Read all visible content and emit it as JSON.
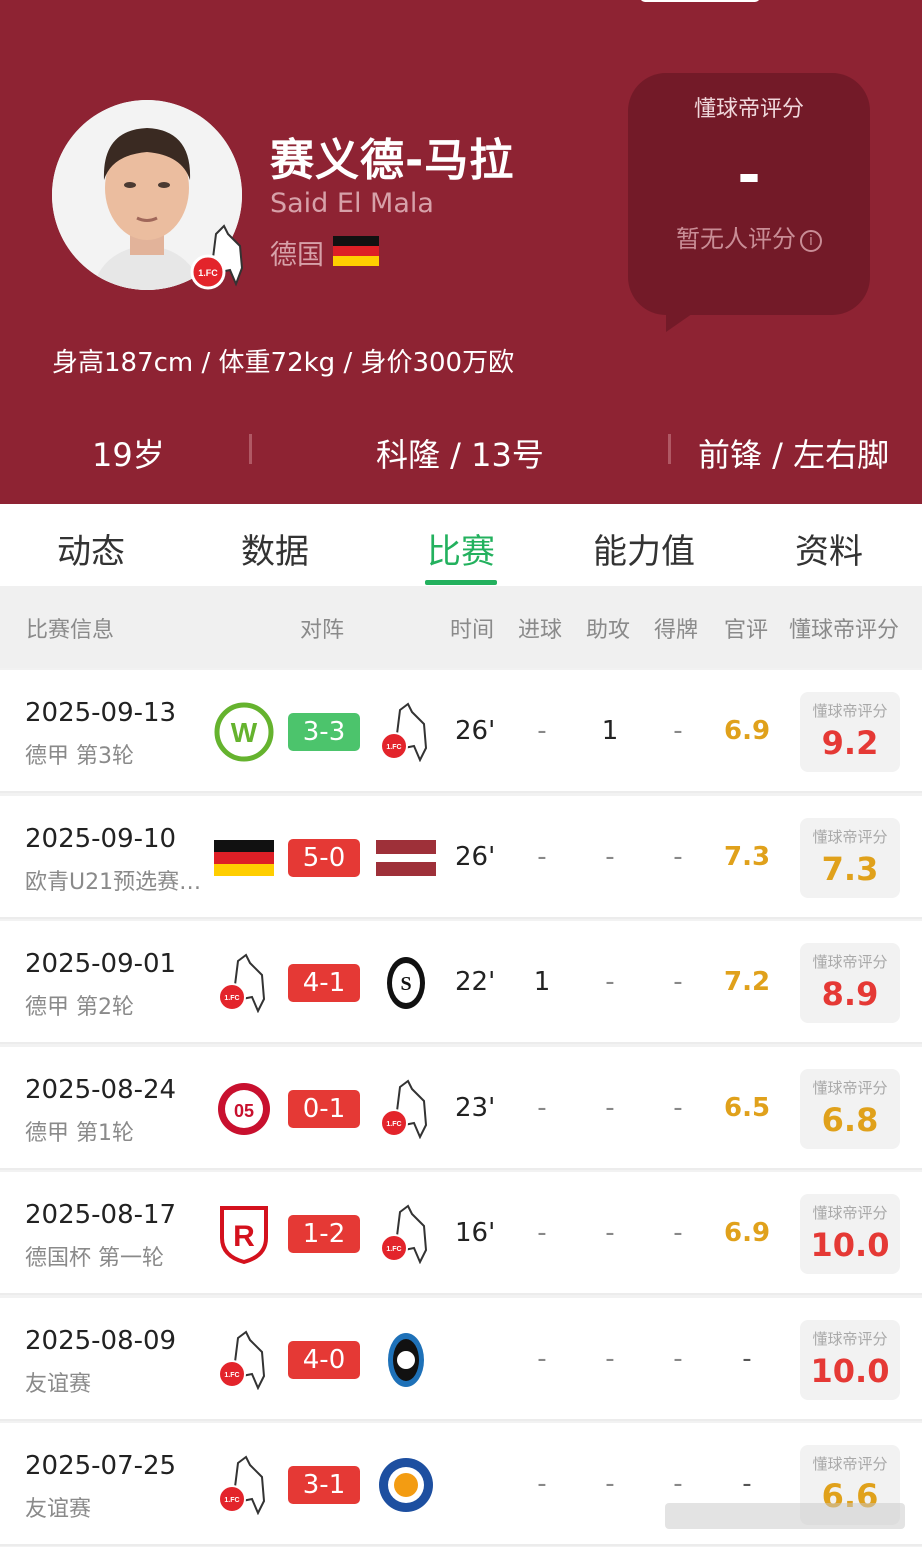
{
  "player": {
    "name_cn": "赛义德-马拉",
    "name_en": "Said El Mala",
    "nationality": "德国",
    "bio": "身高187cm / 体重72kg / 身价300万欧",
    "age": "19岁",
    "club_number": "科隆 / 13号",
    "position_foot": "前锋 / 左右脚"
  },
  "rating": {
    "title": "懂球帝评分",
    "value": "-",
    "note": "暂无人评分"
  },
  "tabs": [
    {
      "label": "动态",
      "active": false
    },
    {
      "label": "数据",
      "active": false
    },
    {
      "label": "比赛",
      "active": true
    },
    {
      "label": "能力值",
      "active": false
    },
    {
      "label": "资料",
      "active": false
    }
  ],
  "table_headers": {
    "match_info": "比赛信息",
    "fixture": "对阵",
    "time": "时间",
    "goals": "进球",
    "assists": "助攻",
    "cards": "得牌",
    "official": "官评",
    "dqd": "懂球帝评分"
  },
  "mini_title": "懂球帝评分",
  "matches": [
    {
      "date": "2025-09-13",
      "competition": "德甲 第3轮",
      "home": "wolfsburg-logo",
      "away": "koln-logo",
      "score": "3-3",
      "score_color": "#4cc46c",
      "minutes": "26'",
      "goals": "-",
      "assists": "1",
      "cards": "-",
      "official": "6.9",
      "dqd": "9.2",
      "dqd_color": "#e53935"
    },
    {
      "date": "2025-09-10",
      "competition": "欧青U21预选赛…",
      "home": "germany-flag",
      "away": "latvia-flag",
      "score": "5-0",
      "score_color": "#e53935",
      "minutes": "26'",
      "goals": "-",
      "assists": "-",
      "cards": "-",
      "official": "7.3",
      "dqd": "7.3",
      "dqd_color": "#e0a11b"
    },
    {
      "date": "2025-09-01",
      "competition": "德甲 第2轮",
      "home": "koln-logo",
      "away": "freiburg-logo",
      "score": "4-1",
      "score_color": "#e53935",
      "minutes": "22'",
      "goals": "1",
      "assists": "-",
      "cards": "-",
      "official": "7.2",
      "dqd": "8.9",
      "dqd_color": "#e53935"
    },
    {
      "date": "2025-08-24",
      "competition": "德甲 第1轮",
      "home": "mainz-logo",
      "away": "koln-logo",
      "score": "0-1",
      "score_color": "#e53935",
      "minutes": "23'",
      "goals": "-",
      "assists": "-",
      "cards": "-",
      "official": "6.5",
      "dqd": "6.8",
      "dqd_color": "#e0a11b"
    },
    {
      "date": "2025-08-17",
      "competition": "德国杯 第一轮",
      "home": "regensburg-logo",
      "away": "koln-logo",
      "score": "1-2",
      "score_color": "#e53935",
      "minutes": "16'",
      "goals": "-",
      "assists": "-",
      "cards": "-",
      "official": "6.9",
      "dqd": "10.0",
      "dqd_color": "#e53935"
    },
    {
      "date": "2025-08-09",
      "competition": "友谊赛",
      "home": "koln-logo",
      "away": "atalanta-logo",
      "score": "4-0",
      "score_color": "#e53935",
      "minutes": "",
      "goals": "-",
      "assists": "-",
      "cards": "-",
      "official": "-",
      "dqd": "10.0",
      "dqd_color": "#e53935"
    },
    {
      "date": "2025-07-25",
      "competition": "友谊赛",
      "home": "koln-logo",
      "away": "leicester-logo",
      "score": "3-1",
      "score_color": "#e53935",
      "minutes": "",
      "goals": "-",
      "assists": "-",
      "cards": "-",
      "official": "-",
      "dqd": "6.6",
      "dqd_color": "#e0a11b"
    }
  ]
}
